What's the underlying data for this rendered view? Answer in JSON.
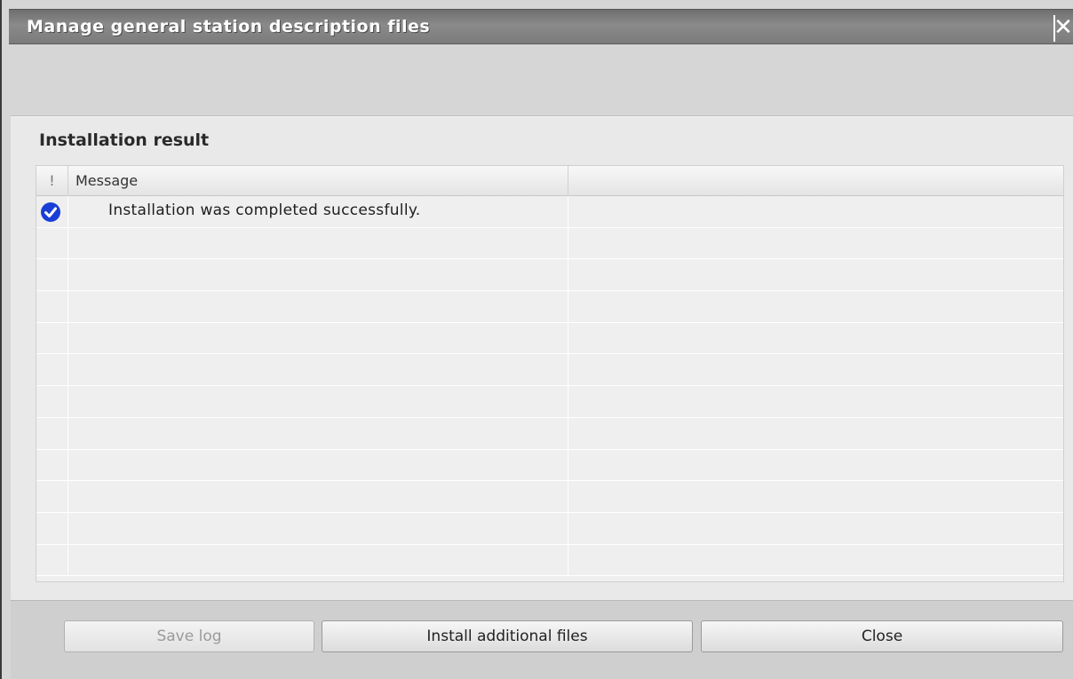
{
  "window": {
    "title": "Manage general station description files",
    "close_glyph": "✕"
  },
  "section": {
    "title": "Installation result"
  },
  "grid": {
    "columns": [
      "!",
      "Message",
      ""
    ],
    "rows": [
      {
        "icon": "success-check-icon",
        "message": "Installation was completed successfully."
      }
    ],
    "empty_row_count": 11
  },
  "footer": {
    "save_log_label": "Save log",
    "install_label": "Install additional files",
    "close_label": "Close"
  },
  "colors": {
    "success_icon": "#1a3fd6",
    "titlebar": "#7b7b7b"
  }
}
